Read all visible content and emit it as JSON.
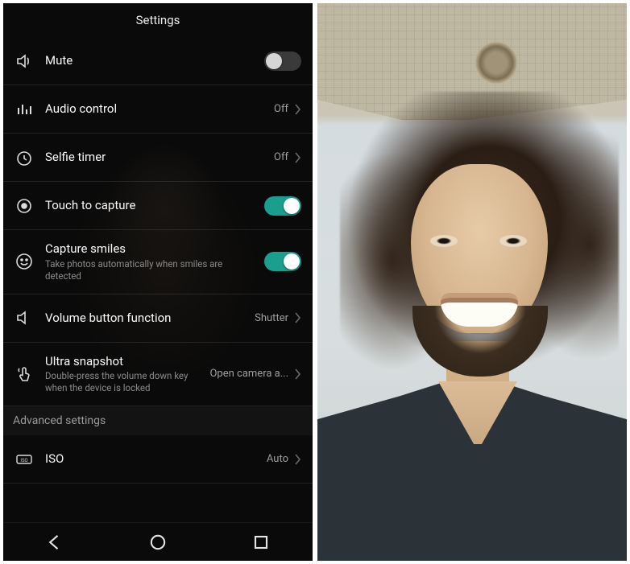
{
  "header": {
    "title": "Settings"
  },
  "settings": {
    "mute": {
      "label": "Mute",
      "icon": "speaker-icon",
      "on": false
    },
    "audio_control": {
      "label": "Audio control",
      "icon": "audio-bars-icon",
      "value": "Off"
    },
    "selfie_timer": {
      "label": "Selfie timer",
      "icon": "timer-icon",
      "value": "Off"
    },
    "touch_capture": {
      "label": "Touch to capture",
      "icon": "target-icon",
      "on": true
    },
    "capture_smiles": {
      "label": "Capture smiles",
      "sub": "Take photos automatically when smiles are detected",
      "icon": "smile-icon",
      "on": true
    },
    "volume_button": {
      "label": "Volume button function",
      "icon": "volume-icon",
      "value": "Shutter"
    },
    "ultra_snapshot": {
      "label": "Ultra snapshot",
      "sub": "Double-press the volume down key when the device is locked",
      "icon": "tap-icon",
      "value": "Open camera a..."
    },
    "advanced_header": "Advanced settings",
    "iso": {
      "label": "ISO",
      "icon": "iso-icon",
      "value": "Auto"
    }
  },
  "nav": {
    "back": "back",
    "home": "home",
    "recent": "recent"
  }
}
